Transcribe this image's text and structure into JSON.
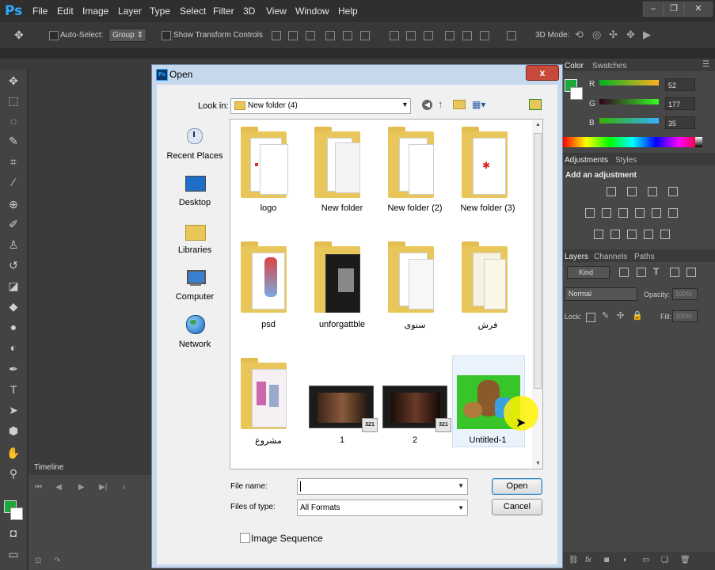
{
  "app": {
    "logo": "Ps",
    "menu": [
      "File",
      "Edit",
      "Image",
      "Layer",
      "Type",
      "Select",
      "Filter",
      "3D",
      "View",
      "Window",
      "Help"
    ]
  },
  "options_bar": {
    "auto_select_label": "Auto-Select:",
    "auto_select_value": "Group",
    "transform_controls_label": "Show Transform Controls",
    "mode_3d_label": "3D Mode:"
  },
  "panels": {
    "color_tab": "Color",
    "swatches_tab": "Swatches",
    "r_label": "R",
    "g_label": "G",
    "b_label": "B",
    "r_value": "52",
    "g_value": "177",
    "b_value": "35",
    "adjustments_tab": "Adjustments",
    "styles_tab": "Styles",
    "add_adjustment": "Add an adjustment",
    "layers_tab": "Layers",
    "channels_tab": "Channels",
    "paths_tab": "Paths",
    "kind_label": "Kind",
    "blend_mode": "Normal",
    "opacity_label": "Opacity:",
    "opacity_value": "100%",
    "lock_label": "Lock:",
    "fill_label": "Fill:",
    "fill_value": "100%"
  },
  "timeline": {
    "title": "Timeline"
  },
  "colors": {
    "foreground": "#1fa83a",
    "background": "#ffffff",
    "ps_blue": "#31a8ff"
  },
  "dialog": {
    "title": "Open",
    "close_label": "x",
    "look_in_label": "Look in:",
    "look_in_value": "New folder (4)",
    "places": [
      "Recent Places",
      "Desktop",
      "Libraries",
      "Computer",
      "Network"
    ],
    "files": [
      {
        "name": "logo",
        "type": "folder"
      },
      {
        "name": "New folder",
        "type": "folder"
      },
      {
        "name": "New folder (2)",
        "type": "folder"
      },
      {
        "name": "New folder (3)",
        "type": "folder"
      },
      {
        "name": "psd",
        "type": "folder"
      },
      {
        "name": "unforgattble",
        "type": "folder"
      },
      {
        "name": "سنوى",
        "type": "folder"
      },
      {
        "name": "فرش",
        "type": "folder"
      },
      {
        "name": "مشروع",
        "type": "folder"
      },
      {
        "name": "1",
        "type": "video"
      },
      {
        "name": "2",
        "type": "video"
      },
      {
        "name": "Untitled-1",
        "type": "image"
      }
    ],
    "video_badge": "321",
    "file_name_label": "File name:",
    "file_name_value": "",
    "files_of_type_label": "Files of type:",
    "files_of_type_value": "All Formats",
    "open_button": "Open",
    "cancel_button": "Cancel",
    "image_sequence_label": "Image Sequence"
  }
}
